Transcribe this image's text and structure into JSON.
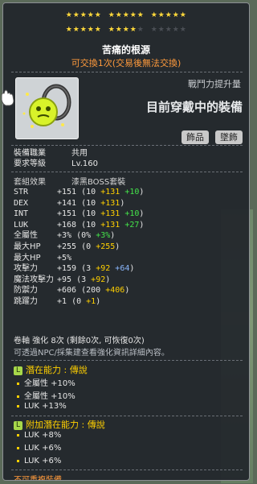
{
  "stars": {
    "row1_on": 15,
    "row1_off": 0,
    "row2_on": 9,
    "row2_off": 6
  },
  "item": {
    "name": "苦痛的根源",
    "trade_note": "可交換1次(交易後無法交換)",
    "cp_label": "戰鬥力提升量",
    "equipped_text": "目前穿戴中的裝備",
    "tags": [
      "飾品",
      "墜飾"
    ]
  },
  "info": {
    "job_label": "裝備職業",
    "job_value": "共用",
    "req_label": "要求等級",
    "req_value": "Lv.160",
    "set_label": "套組效果",
    "set_value": "漆黑BOSS套裝"
  },
  "stats": [
    {
      "name": "STR",
      "total": "+151",
      "base": "10",
      "scroll": "+131",
      "star": "+10"
    },
    {
      "name": "DEX",
      "total": "+141",
      "base": "10",
      "scroll": "+131",
      "star": ""
    },
    {
      "name": "INT",
      "total": "+151",
      "base": "10",
      "scroll": "+131",
      "star": "+10"
    },
    {
      "name": "LUK",
      "total": "+168",
      "base": "10",
      "scroll": "+131",
      "star": "+27"
    },
    {
      "name": "全屬性",
      "total": "+3%",
      "base": "0%",
      "scroll": "",
      "star": "+3%"
    },
    {
      "name": "最大HP",
      "total": "+255",
      "base": "0",
      "scroll": "+255",
      "star": ""
    },
    {
      "name": "最大HP",
      "total": "+5%",
      "base": "",
      "scroll": "",
      "star": ""
    },
    {
      "name": "攻擊力",
      "total": "+159",
      "base": "3",
      "scroll": "+92",
      "star": "+64"
    },
    {
      "name": "魔法攻擊力",
      "total": "+95",
      "base": "3",
      "scroll": "+92",
      "star": ""
    },
    {
      "name": "防禦力",
      "total": "+606",
      "base": "200",
      "scroll": "+406",
      "star": ""
    },
    {
      "name": "跳躍力",
      "total": "+1",
      "base": "0",
      "scroll": "+1",
      "star": ""
    }
  ],
  "scroll_line": "卷軸 強化 8次 (剩餘0次, 可恢復0次)",
  "note_line": "可透過NPC/採集建查看強化資訊詳細內容。",
  "potential": {
    "header": "潛在能力 : 傳說",
    "badge": "L",
    "lines": [
      "全屬性 +10%",
      "全屬性 +10%",
      "LUK +13%"
    ]
  },
  "additional": {
    "header": "附加潛在能力 : 傳說",
    "badge": "L",
    "lines": [
      "LUK +8%",
      "LUK +6%",
      "LUK +6%"
    ]
  },
  "footer": "不可重複裝備",
  "colors": {
    "star_on": "#ffd93b",
    "scroll_bonus": "#ffd000",
    "star_bonus": "#44e44a",
    "magic_bonus": "#8bb8ff",
    "legend": "#a7d84a"
  }
}
